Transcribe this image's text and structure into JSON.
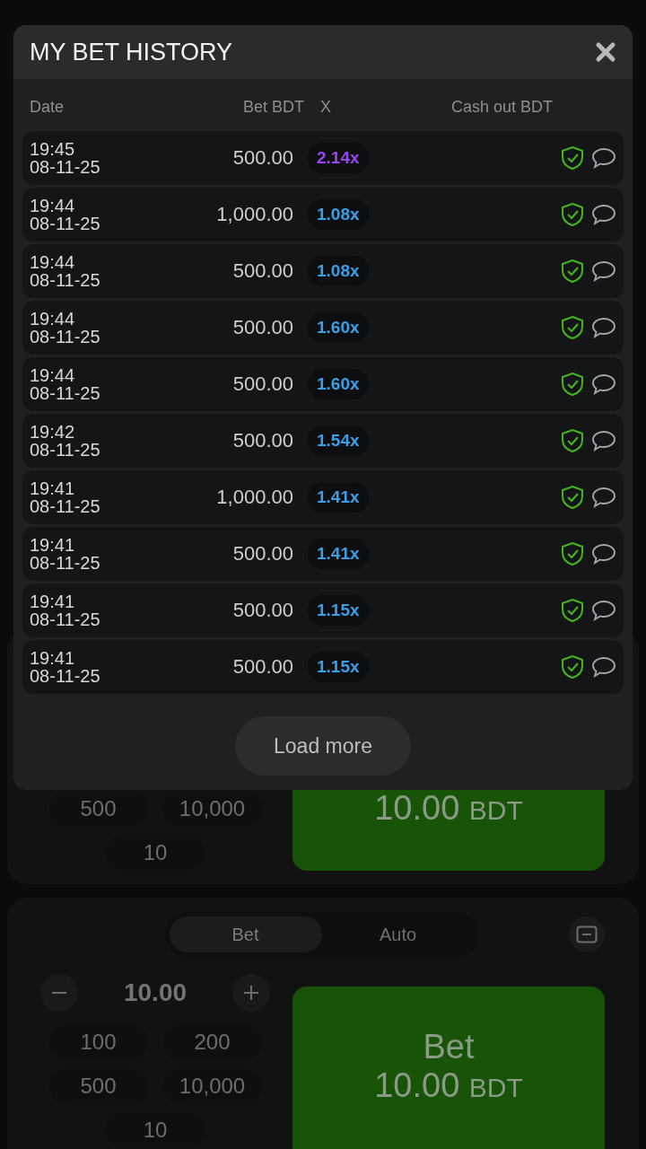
{
  "modal": {
    "title": "MY BET HISTORY",
    "columns": [
      "Date",
      "Bet BDT",
      "X",
      "Cash out BDT"
    ],
    "rows": [
      {
        "time": "19:45",
        "date": "08-11-25",
        "bet": "500.00",
        "multiplier": "2.14x",
        "color": "#9b45f0"
      },
      {
        "time": "19:44",
        "date": "08-11-25",
        "bet": "1,000.00",
        "multiplier": "1.08x",
        "color": "#3a9fe6"
      },
      {
        "time": "19:44",
        "date": "08-11-25",
        "bet": "500.00",
        "multiplier": "1.08x",
        "color": "#3a9fe6"
      },
      {
        "time": "19:44",
        "date": "08-11-25",
        "bet": "500.00",
        "multiplier": "1.60x",
        "color": "#3a9fe6"
      },
      {
        "time": "19:44",
        "date": "08-11-25",
        "bet": "500.00",
        "multiplier": "1.60x",
        "color": "#3a9fe6"
      },
      {
        "time": "19:42",
        "date": "08-11-25",
        "bet": "500.00",
        "multiplier": "1.54x",
        "color": "#3a9fe6"
      },
      {
        "time": "19:41",
        "date": "08-11-25",
        "bet": "1,000.00",
        "multiplier": "1.41x",
        "color": "#3a9fe6"
      },
      {
        "time": "19:41",
        "date": "08-11-25",
        "bet": "500.00",
        "multiplier": "1.41x",
        "color": "#3a9fe6"
      },
      {
        "time": "19:41",
        "date": "08-11-25",
        "bet": "500.00",
        "multiplier": "1.15x",
        "color": "#3a9fe6"
      },
      {
        "time": "19:41",
        "date": "08-11-25",
        "bet": "500.00",
        "multiplier": "1.15x",
        "color": "#3a9fe6"
      }
    ],
    "load_more": "Load more"
  },
  "bet_panels": [
    {
      "chips": [
        "500",
        "10,000",
        "10"
      ],
      "button": {
        "amount": "10.00",
        "currency": "BDT"
      }
    },
    {
      "tabs": [
        {
          "label": "Bet",
          "selected": true
        },
        {
          "label": "Auto",
          "selected": false
        }
      ],
      "stake": "10.00",
      "chips": [
        "100",
        "200",
        "500",
        "10,000",
        "10"
      ],
      "button": {
        "label": "Bet",
        "amount": "10.00",
        "currency": "BDT"
      }
    }
  ]
}
